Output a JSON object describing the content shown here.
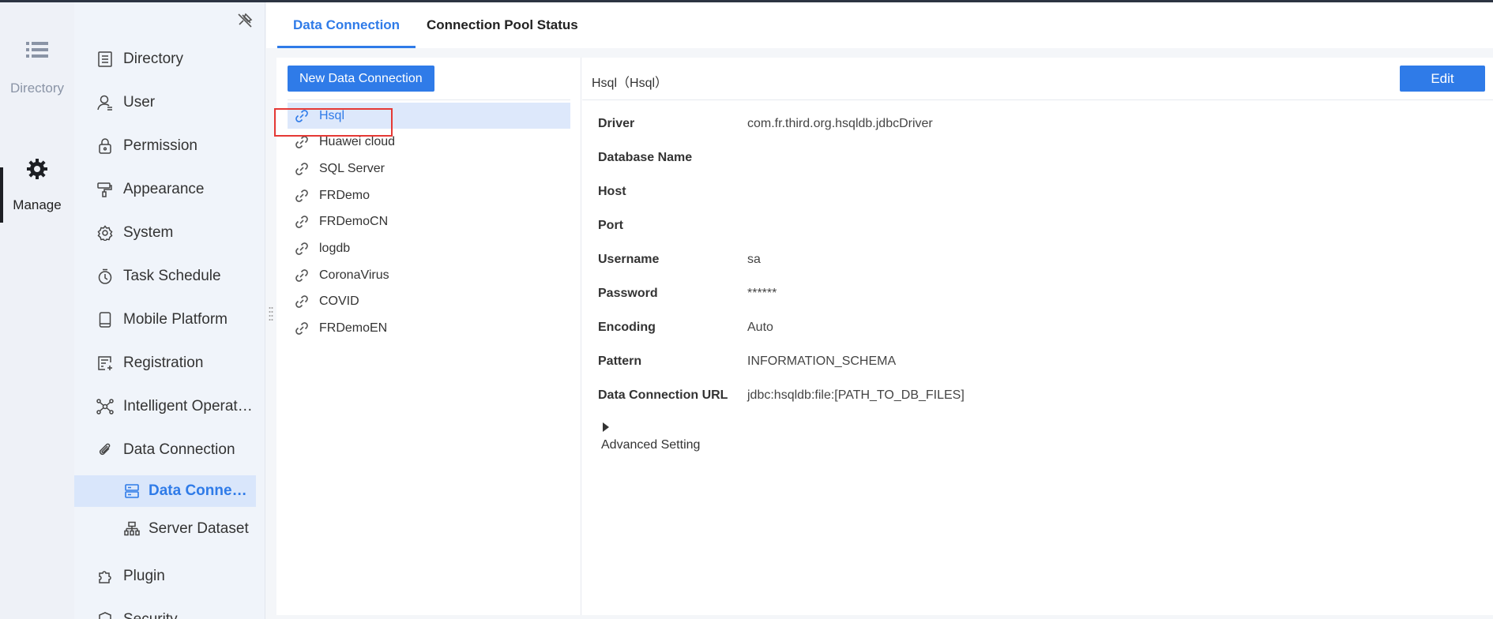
{
  "rail": {
    "items": [
      {
        "label": "Directory",
        "icon": "list-icon"
      },
      {
        "label": "Manage",
        "icon": "gear-icon"
      }
    ]
  },
  "sidebar": {
    "items": [
      {
        "label": "Directory",
        "icon": "directory-icon"
      },
      {
        "label": "User",
        "icon": "user-icon"
      },
      {
        "label": "Permission",
        "icon": "lock-icon"
      },
      {
        "label": "Appearance",
        "icon": "paint-roller-icon"
      },
      {
        "label": "System",
        "icon": "settings-icon"
      },
      {
        "label": "Task Schedule",
        "icon": "timer-icon"
      },
      {
        "label": "Mobile Platform",
        "icon": "mobile-icon"
      },
      {
        "label": "Registration",
        "icon": "registration-icon"
      },
      {
        "label": "Intelligent Operat…",
        "icon": "network-icon"
      },
      {
        "label": "Data Connection",
        "icon": "paperclip-icon"
      },
      {
        "label": "Plugin",
        "icon": "puzzle-icon"
      },
      {
        "label": "Security",
        "icon": "shield-icon"
      }
    ],
    "subitems": [
      {
        "label": "Data Conne…",
        "icon": "server-icon"
      },
      {
        "label": "Server Dataset",
        "icon": "dataset-icon"
      }
    ]
  },
  "tabs": [
    {
      "label": "Data Connection"
    },
    {
      "label": "Connection Pool Status"
    }
  ],
  "list": {
    "new_button": "New Data Connection",
    "connections": [
      "Hsql",
      "Huawei cloud",
      "SQL Server",
      "FRDemo",
      "FRDemoCN",
      "logdb",
      "CoronaVirus",
      "COVID",
      "FRDemoEN"
    ]
  },
  "detail": {
    "title": "Hsql（Hsql）",
    "edit_button": "Edit",
    "fields": [
      {
        "key": "Driver",
        "value": "com.fr.third.org.hsqldb.jdbcDriver"
      },
      {
        "key": "Database Name",
        "value": ""
      },
      {
        "key": "Host",
        "value": ""
      },
      {
        "key": "Port",
        "value": ""
      },
      {
        "key": "Username",
        "value": "sa"
      },
      {
        "key": "Password",
        "value": "******"
      },
      {
        "key": "Encoding",
        "value": "Auto"
      },
      {
        "key": "Pattern",
        "value": "INFORMATION_SCHEMA"
      },
      {
        "key": "Data Connection URL",
        "value": "jdbc:hsqldb:file:[PATH_TO_DB_FILES]"
      }
    ],
    "advanced_label": "Advanced Setting"
  },
  "colors": {
    "accent": "#2f7be8",
    "highlight": "#e53935"
  }
}
